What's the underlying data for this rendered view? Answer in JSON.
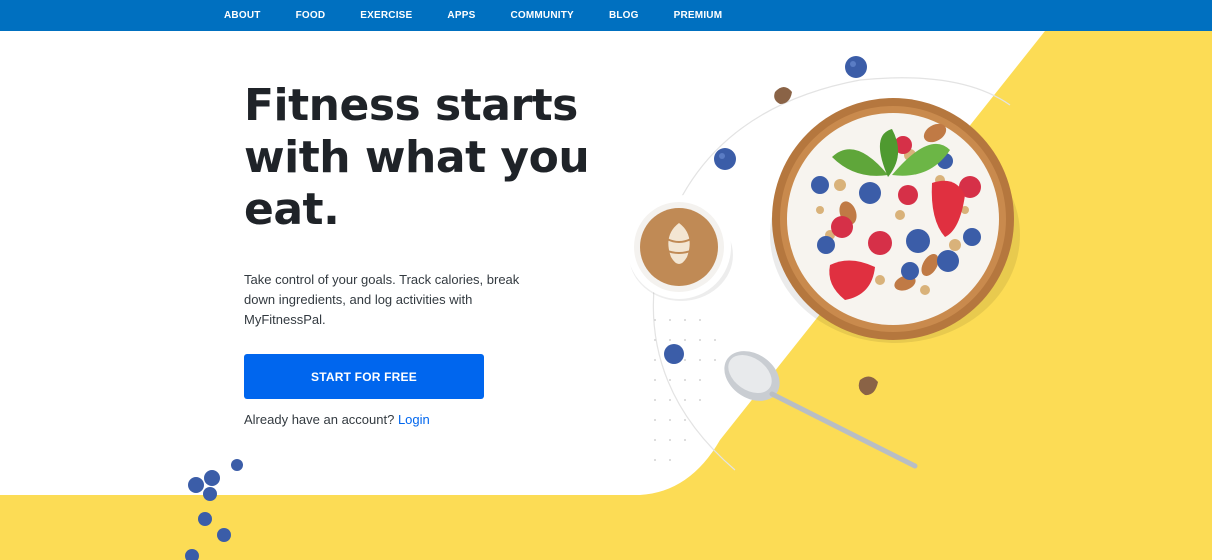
{
  "nav": {
    "items": [
      {
        "label": "ABOUT"
      },
      {
        "label": "FOOD"
      },
      {
        "label": "EXERCISE"
      },
      {
        "label": "APPS"
      },
      {
        "label": "COMMUNITY"
      },
      {
        "label": "BLOG"
      },
      {
        "label": "PREMIUM"
      }
    ]
  },
  "hero": {
    "headline_line1": "Fitness starts",
    "headline_line2": "with what you",
    "headline_line3": "eat.",
    "subtext": "Take control of your goals. Track calories, break down ingredients, and log activities with MyFitnessPal.",
    "cta_label": "START FOR FREE",
    "account_prompt": "Already have an account?",
    "login_label": "Login"
  },
  "colors": {
    "nav_bg": "#0070c0",
    "cta_bg": "#0066ee",
    "yellow": "#fcdc55",
    "heading": "#1f2328"
  }
}
